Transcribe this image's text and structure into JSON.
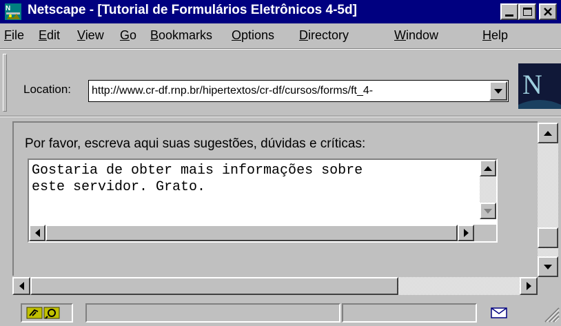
{
  "window": {
    "title": "Netscape - [Tutorial de Formulários Eletrônicos 4-5d]",
    "buttons": {
      "minimize": "minimize",
      "maximize": "maximize",
      "close": "close"
    }
  },
  "menu": {
    "items": [
      {
        "label": "File",
        "accel": "F",
        "rest": "ile"
      },
      {
        "label": "Edit",
        "accel": "E",
        "rest": "dit"
      },
      {
        "label": "View",
        "accel": "V",
        "rest": "iew"
      },
      {
        "label": "Go",
        "accel": "G",
        "rest": "o"
      },
      {
        "label": "Bookmarks",
        "accel": "B",
        "rest": "ookmarks"
      },
      {
        "label": "Options",
        "accel": "O",
        "rest": "ptions"
      },
      {
        "label": "Directory",
        "accel": "D",
        "rest": "irectory"
      },
      {
        "label": "Window",
        "accel": "W",
        "rest": "indow"
      },
      {
        "label": "Help",
        "accel": "H",
        "rest": "elp"
      }
    ]
  },
  "location": {
    "label": "Location:",
    "url": "http://www.cr-df.rnp.br/hipertextos/cr-df/cursos/forms/ft_4-"
  },
  "logo": {
    "letter": "N",
    "icon": "netscape-logo"
  },
  "form": {
    "prompt": "Por favor, escreva aqui suas sugestões, dúvidas e críticas:",
    "textarea_text": "Gostaria de obter mais informações sobre\neste servidor. Grato."
  },
  "colors": {
    "title_bg": "#000080",
    "chrome": "#c0c0c0",
    "field_bg": "#ffffff"
  },
  "icons": {
    "app": "netscape-app-icon",
    "security": "security-key-icon",
    "mail": "mail-envelope-icon"
  }
}
